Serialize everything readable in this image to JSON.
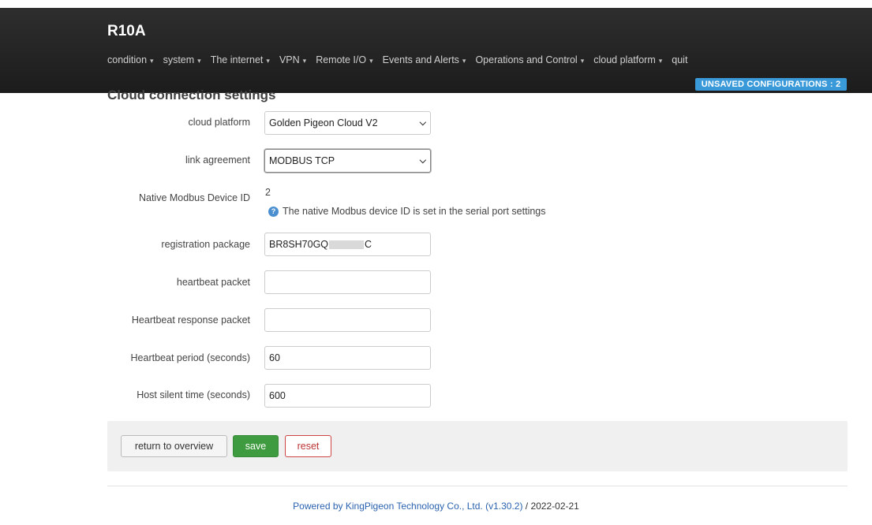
{
  "app": {
    "brand": "R10A"
  },
  "nav": {
    "items": [
      {
        "label": "condition",
        "dropdown": true
      },
      {
        "label": "system",
        "dropdown": true
      },
      {
        "label": "The internet",
        "dropdown": true
      },
      {
        "label": "VPN",
        "dropdown": true
      },
      {
        "label": "Remote I/O",
        "dropdown": true
      },
      {
        "label": "Events and Alerts",
        "dropdown": true
      },
      {
        "label": "Operations and Control",
        "dropdown": true
      },
      {
        "label": "cloud platform",
        "dropdown": true
      },
      {
        "label": "quit",
        "dropdown": false
      }
    ],
    "caret": "▾"
  },
  "badge": {
    "unsaved": "UNSAVED CONFIGURATIONS : 2"
  },
  "section": {
    "title": "Cloud connection settings"
  },
  "form": {
    "cloud_platform": {
      "label": "cloud platform",
      "value": "Golden Pigeon Cloud V2"
    },
    "link_agreement": {
      "label": "link agreement",
      "value": "MODBUS TCP"
    },
    "device_id": {
      "label": "Native Modbus Device ID",
      "value": "2",
      "hint": "The native Modbus device ID is set in the serial port settings"
    },
    "registration_package": {
      "label": "registration package",
      "value_prefix": "BR8SH70GQ",
      "value_suffix": "C"
    },
    "heartbeat_packet": {
      "label": "heartbeat packet",
      "value": ""
    },
    "heartbeat_response": {
      "label": "Heartbeat response packet",
      "value": ""
    },
    "heartbeat_period": {
      "label": "Heartbeat period (seconds)",
      "value": "60"
    },
    "host_silent_time": {
      "label": "Host silent time (seconds)",
      "value": "600"
    }
  },
  "actions": {
    "overview": "return to overview",
    "save": "save",
    "reset": "reset"
  },
  "footer": {
    "link": "Powered by KingPigeon Technology Co., Ltd. (v1.30.2)",
    "date": " / 2022-02-21"
  },
  "colors": {
    "accent_badge": "#3a9ad9",
    "save_button": "#3f9b3f",
    "reset_button": "#cc4444",
    "footer_link": "#2a62b0"
  }
}
